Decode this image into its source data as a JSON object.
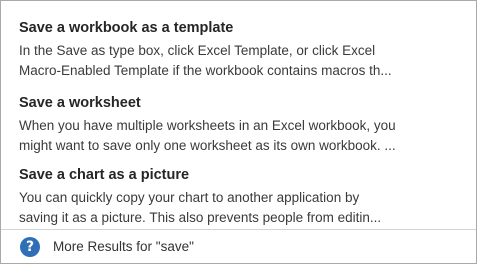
{
  "results": [
    {
      "title": "Save a workbook as a template",
      "description_lines": [
        "In the Save as type box, click Excel Template, or click Excel",
        "Macro-Enabled Template if the workbook contains macros th..."
      ]
    },
    {
      "title": "Save a worksheet",
      "description_lines": [
        "When you have multiple worksheets in an Excel workbook, you",
        "might want to save only one worksheet as its own workbook. ..."
      ]
    },
    {
      "title": "Save a chart as a picture",
      "description_lines": [
        "You can quickly copy your chart to another application by",
        "saving it as a picture. This also prevents people from editin..."
      ]
    }
  ],
  "footer": {
    "icon": "help-question-icon",
    "icon_glyph": "?",
    "label": "More Results for \"save\"",
    "icon_color": "#2f6fb6"
  }
}
